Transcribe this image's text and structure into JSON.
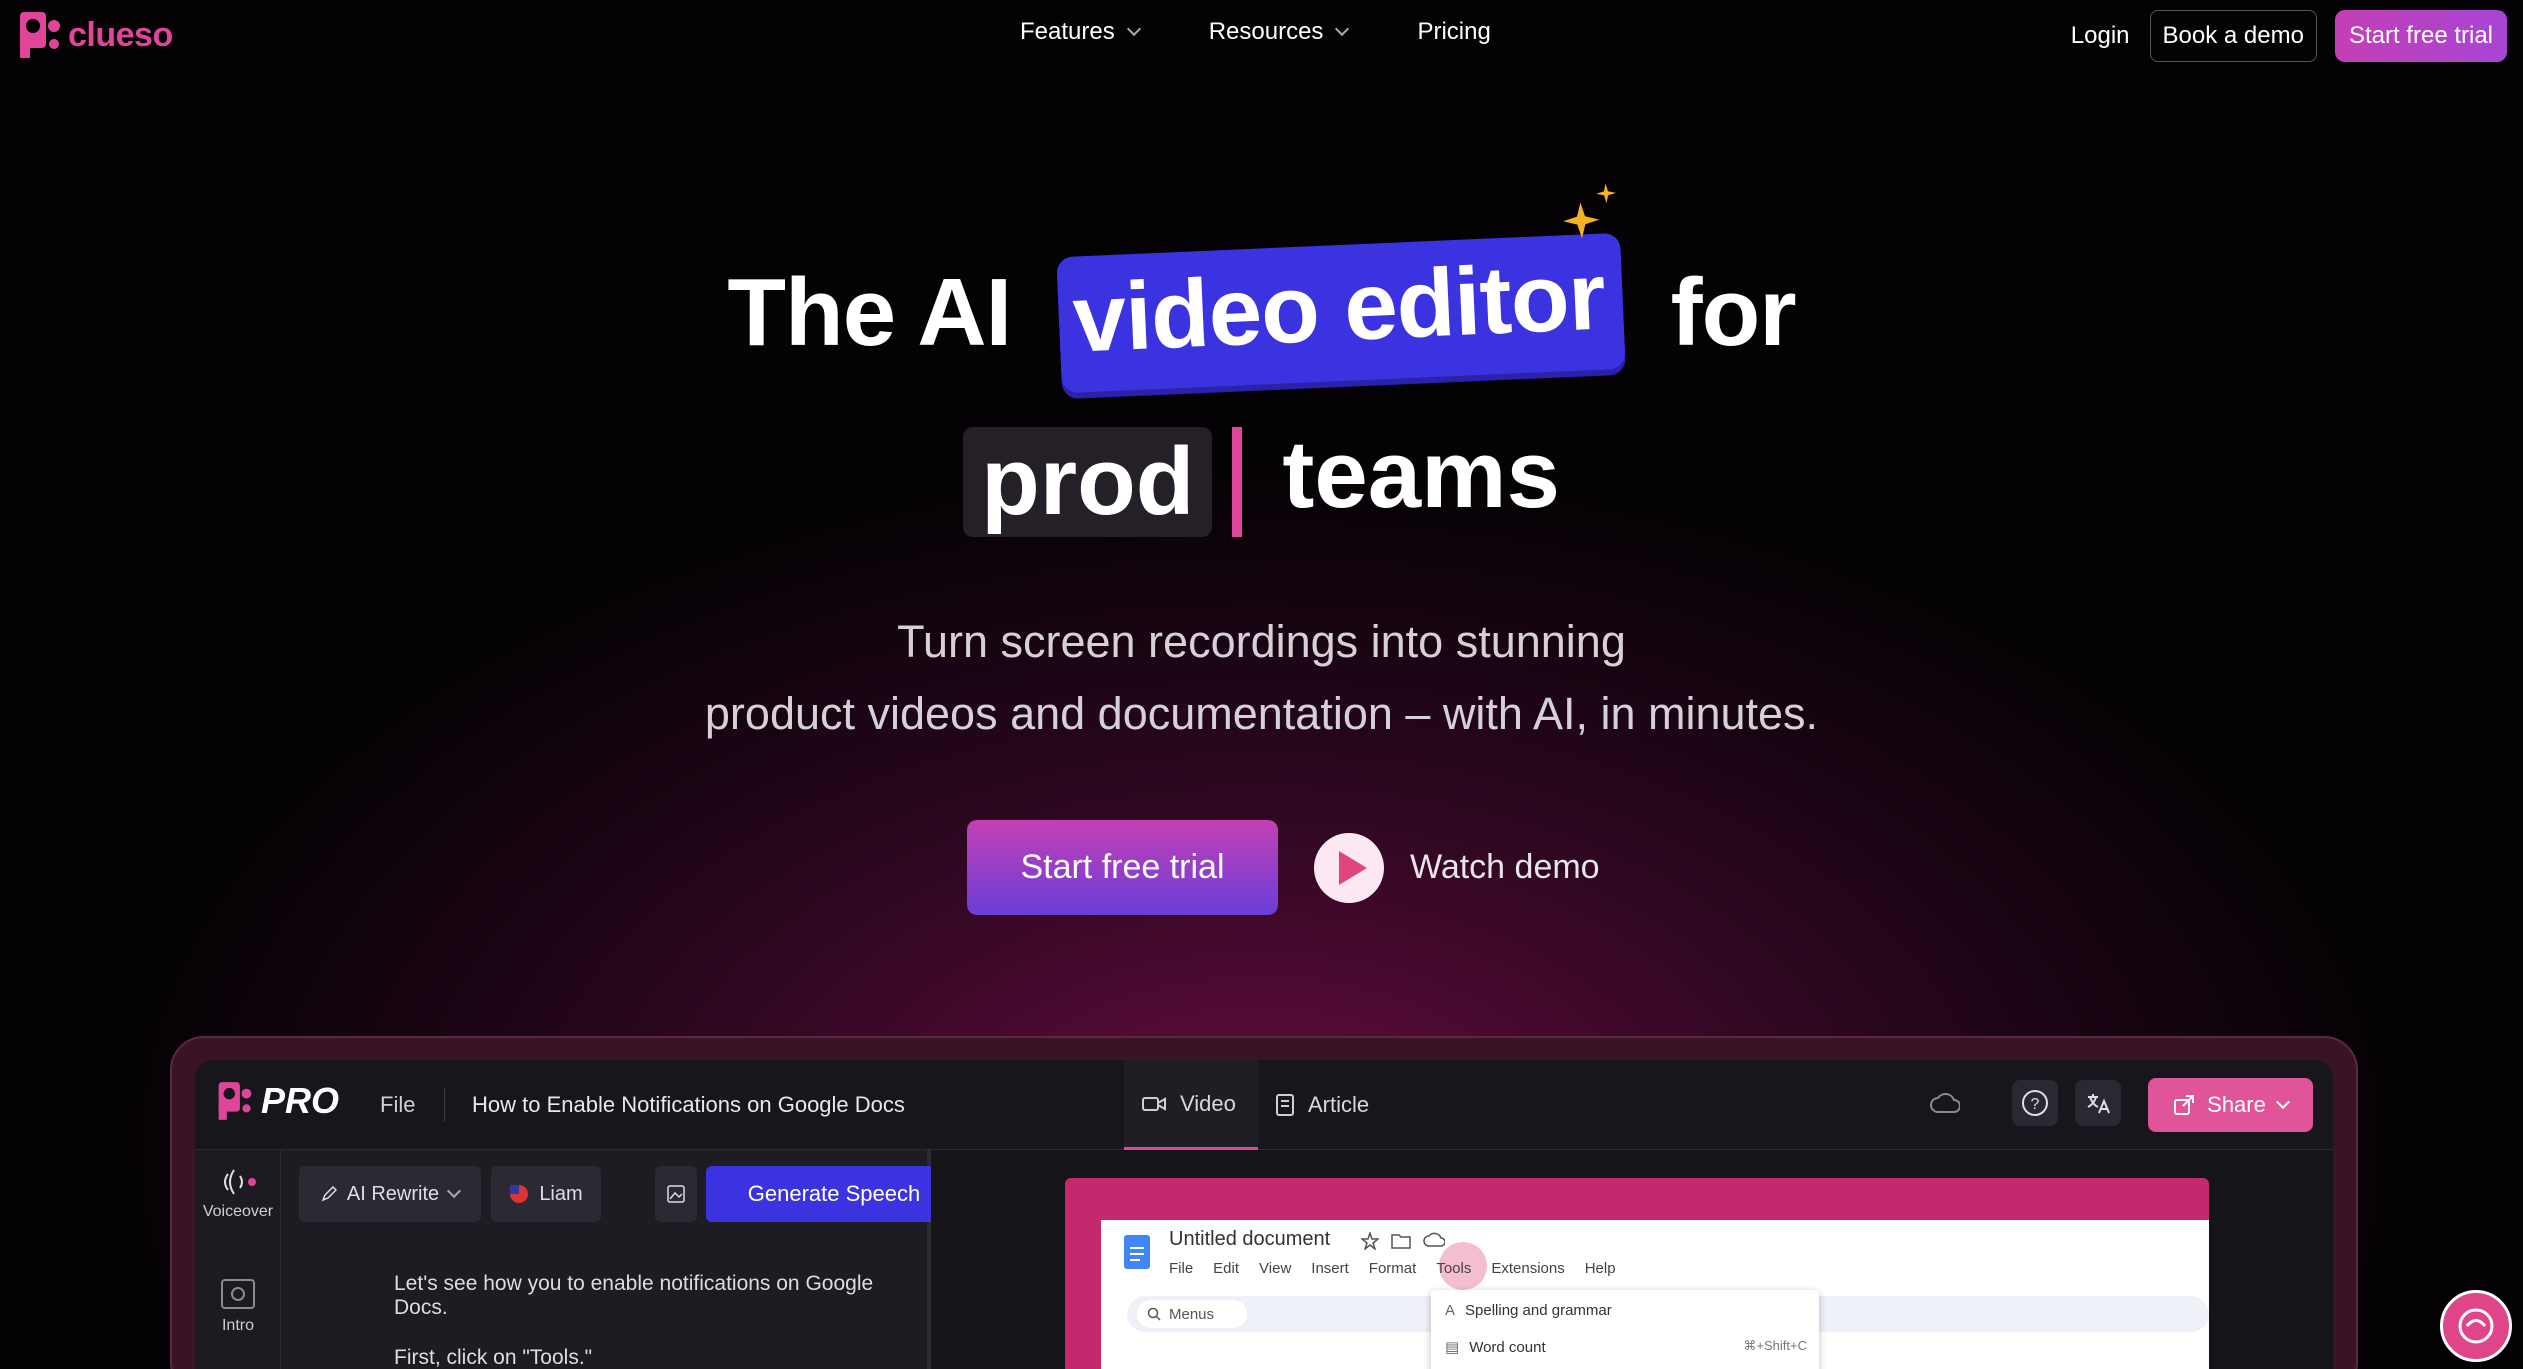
{
  "nav": {
    "brand": "clueso",
    "items": [
      {
        "label": "Features"
      },
      {
        "label": "Resources"
      },
      {
        "label": "Pricing"
      }
    ],
    "login": "Login",
    "book_demo": "Book a demo",
    "start_trial": "Start free trial"
  },
  "hero": {
    "line1_prefix": "The AI",
    "highlight": "video editor",
    "line1_suffix": "for",
    "typed_word": "prod",
    "line2_suffix": "teams",
    "sub_line1": "Turn screen recordings into stunning",
    "sub_line2": "product videos and documentation – with AI, in minutes.",
    "cta_primary": "Start free trial",
    "cta_secondary": "Watch demo"
  },
  "app": {
    "badge": "PRO",
    "file_menu": "File",
    "doc_title": "How to Enable Notifications on Google Docs",
    "tabs": [
      {
        "label": "Video",
        "icon": "video-icon"
      },
      {
        "label": "Article",
        "icon": "article-icon"
      }
    ],
    "share": "Share",
    "sidebar": [
      {
        "label": "Voiceover",
        "icon": "voiceover-icon"
      },
      {
        "label": "Intro",
        "icon": "intro-icon"
      }
    ],
    "toolbar": {
      "rewrite": "AI Rewrite",
      "voice": "Liam",
      "generate": "Generate Speech"
    },
    "script": [
      "Let's see how you to enable notifications on Google Docs.",
      "First, click on \"Tools.\""
    ],
    "preview": {
      "doc_name": "Untitled document",
      "menu": [
        "File",
        "Edit",
        "View",
        "Insert",
        "Format",
        "Tools",
        "Extensions",
        "Help"
      ],
      "search": "Menus",
      "dropdown": [
        {
          "label": "Spelling and grammar",
          "shortcut": ""
        },
        {
          "label": "Word count",
          "shortcut": "⌘+Shift+C"
        }
      ]
    }
  },
  "colors": {
    "accent_pink": "#e0459a",
    "accent_blue": "#3b33e0",
    "background": "#000000"
  }
}
